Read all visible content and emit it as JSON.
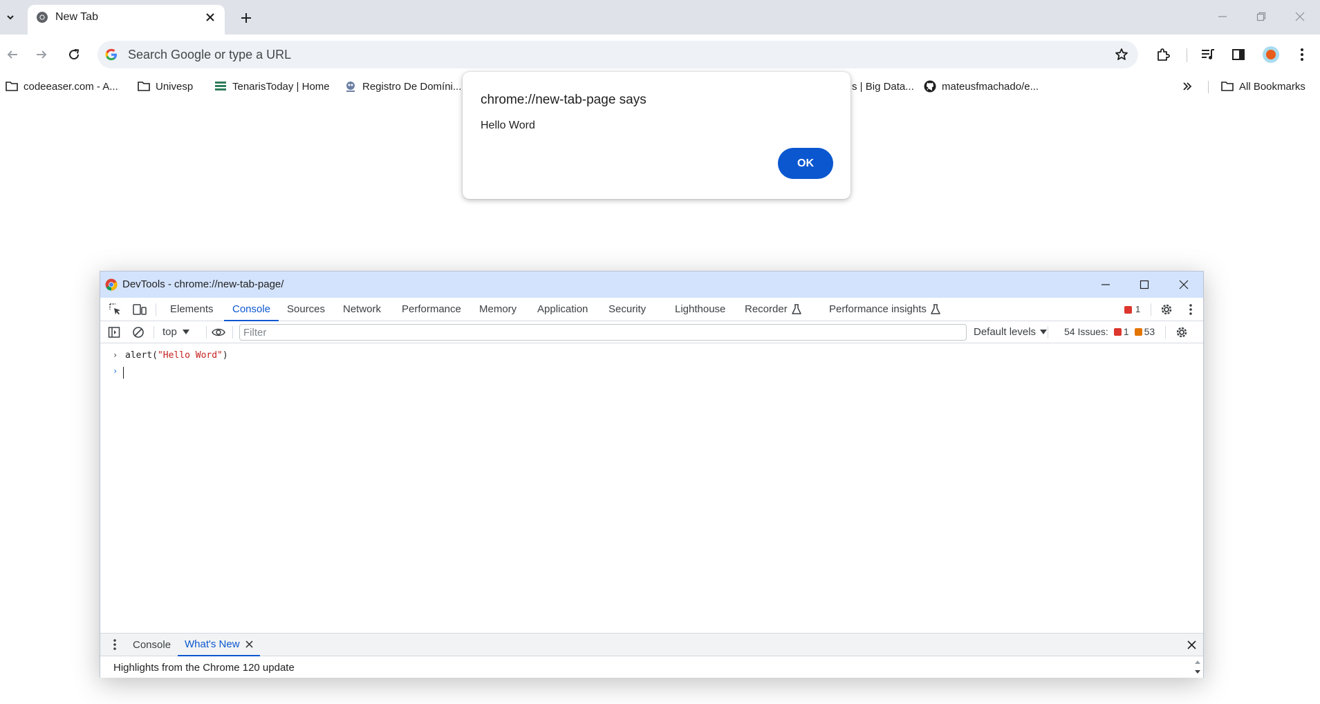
{
  "browser": {
    "tab": {
      "title": "New Tab"
    },
    "omnibox": {
      "placeholder": "Search Google or type a URL"
    },
    "bookmarks": [
      {
        "label": "codeeaser.com - A...",
        "icon": "folder-icon"
      },
      {
        "label": "Univesp",
        "icon": "folder-icon"
      },
      {
        "label": "TenarisToday | Home",
        "icon": "site-icon"
      },
      {
        "label": "Registro De Domíni...",
        "icon": "site-icon"
      },
      {
        "label": "s | Big Data...",
        "icon": "none"
      },
      {
        "label": "mateusfmachado/e...",
        "icon": "github-icon"
      }
    ],
    "all_bookmarks_label": "All Bookmarks"
  },
  "alert": {
    "title": "chrome://new-tab-page says",
    "message": "Hello Word",
    "ok_label": "OK"
  },
  "devtools": {
    "window_title": "DevTools - chrome://new-tab-page/",
    "tabs": [
      "Elements",
      "Console",
      "Sources",
      "Network",
      "Performance",
      "Memory",
      "Application",
      "Security",
      "Lighthouse",
      "Recorder",
      "Performance insights"
    ],
    "active_tab": "Console",
    "error_count": "1",
    "console_toolbar": {
      "context": "top",
      "filter_placeholder": "Filter",
      "levels": "Default levels",
      "issues_label": "54 Issues:",
      "issues_errors": "1",
      "issues_warnings": "53"
    },
    "console": {
      "command_prefix": "alert(",
      "command_string": "\"Hello Word\"",
      "command_suffix": ")"
    },
    "drawer": {
      "tabs": [
        "Console",
        "What's New"
      ],
      "active_tab": "What's New",
      "content": "Highlights from the Chrome 120 update"
    }
  },
  "colors": {
    "tabstrip": "#dfe3e9",
    "devtools_titlebar": "#d3e3fd",
    "accent": "#0b57d0",
    "error": "#dc362e",
    "warning": "#e37400",
    "console_string": "#c5221f"
  }
}
